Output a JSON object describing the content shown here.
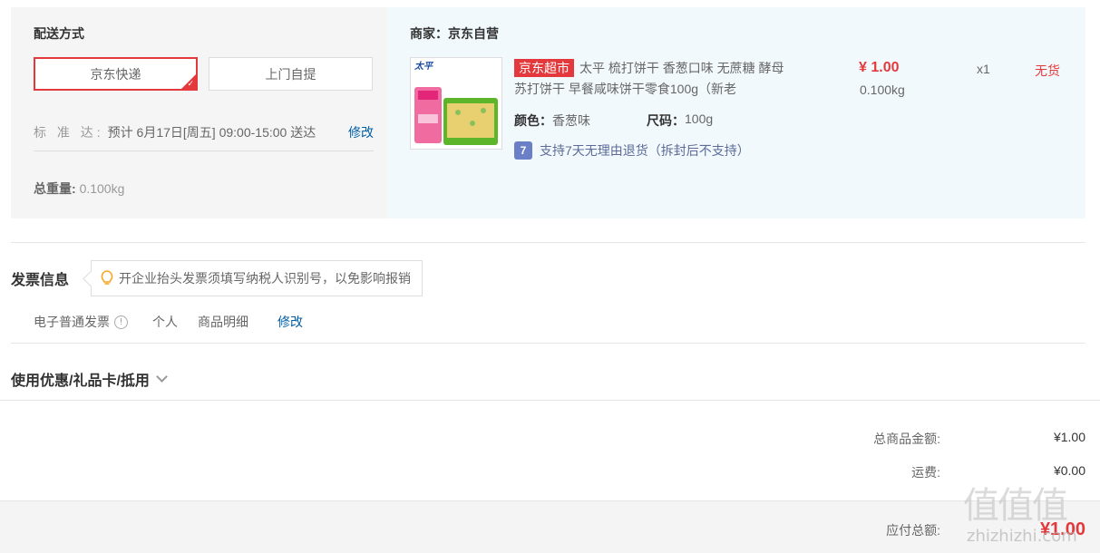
{
  "shipping": {
    "section_label": "配送方式",
    "options": [
      "京东快递",
      "上门自提"
    ],
    "selected_index": 0,
    "eta_label": "标 准 达:",
    "eta_text": "预计 6月17日[周五] 09:00-15:00 送达",
    "eta_modify": "修改",
    "total_weight_label": "总重量:",
    "total_weight_value": "0.100kg"
  },
  "goods": {
    "seller": "商家：京东自营",
    "tag": "京东超市",
    "title": "太平 梳打饼干 香葱口味 无蔗糖 酵母苏打饼干 早餐咸味饼干零食100g（新老",
    "price": "¥ 1.00",
    "weight": "0.100kg",
    "quantity": "x1",
    "stock_status": "无货",
    "color_label": "颜色：",
    "color_value": "香葱味",
    "size_label": "尺码：",
    "size_value": "100g",
    "return_icon": "7",
    "return_text": "支持7天无理由退货（拆封后不支持）",
    "thumb_text": "太平"
  },
  "invoice": {
    "title": "发票信息",
    "tip": "开企业抬头发票须填写纳税人识别号，以免影响报销",
    "type": "电子普通发票",
    "header": "个人",
    "content": "商品明细",
    "modify": "修改"
  },
  "coupon": {
    "title": "使用优惠/礼品卡/抵用"
  },
  "summary": {
    "goods_total_label": "总商品金额:",
    "goods_total_value": "¥1.00",
    "freight_label": "运费:",
    "freight_value": "¥0.00",
    "payable_label": "应付总额:",
    "payable_value": "¥1.00"
  },
  "watermark": {
    "main": "值值值",
    "sub": "zhizhizhi.com"
  },
  "colors": {
    "accent": "#e4393c",
    "link": "#005ea7",
    "goods_bg": "#f2f9fd",
    "ship_bg": "#f5f5f5"
  }
}
